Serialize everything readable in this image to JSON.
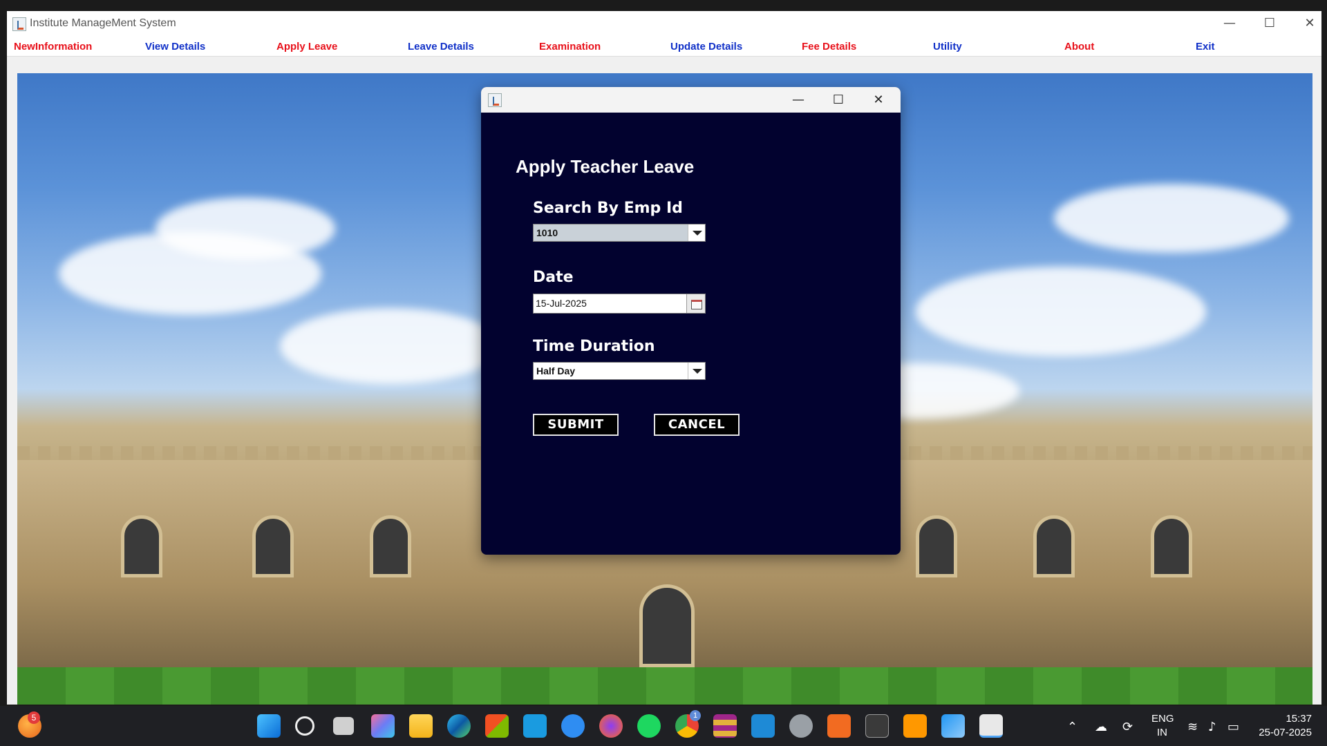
{
  "app": {
    "title": "Institute ManageMent System",
    "controls": {
      "minimize": "—",
      "maximize": "☐",
      "close": "✕"
    }
  },
  "menu": {
    "items": [
      {
        "label": "NewInformation",
        "color": "#e8101a"
      },
      {
        "label": "View Details",
        "color": "#1030c8"
      },
      {
        "label": "Apply Leave",
        "color": "#e8101a"
      },
      {
        "label": "Leave Details",
        "color": "#1030c8"
      },
      {
        "label": "Examination",
        "color": "#e8101a"
      },
      {
        "label": "Update Details",
        "color": "#1030c8"
      },
      {
        "label": "Fee Details",
        "color": "#e8101a"
      },
      {
        "label": "Utility",
        "color": "#1030c8"
      },
      {
        "label": "About",
        "color": "#e8101a"
      },
      {
        "label": "Exit",
        "color": "#1030c8"
      }
    ]
  },
  "dialog": {
    "controls": {
      "minimize": "—",
      "maximize": "☐",
      "close": "✕"
    },
    "heading": "Apply Teacher Leave",
    "emp_label": "Search By Emp Id",
    "emp_value": "1010",
    "date_label": "Date",
    "date_value": "15-Jul-2025",
    "duration_label": "Time Duration",
    "duration_value": "Half Day",
    "submit_label": "SUBMIT",
    "cancel_label": "CANCEL",
    "background": "#02022f"
  },
  "taskbar": {
    "notification_badge": "5",
    "chrome_badge": "1",
    "language": "ENG",
    "region": "IN",
    "time": "15:37",
    "date": "25-07-2025",
    "icons": [
      "avatar-icon",
      "windows-start-icon",
      "search-icon",
      "task-view-icon",
      "copilot-icon",
      "file-explorer-icon",
      "edge-icon",
      "microsoft-store-icon",
      "myhp-icon",
      "help-icon",
      "firefox-icon",
      "spotify-icon",
      "chrome-icon",
      "winrar-icon",
      "vscode-icon",
      "settings-icon",
      "xampp-icon",
      "terminal-icon",
      "sublime-icon",
      "app-icon",
      "java-app-icon"
    ]
  }
}
